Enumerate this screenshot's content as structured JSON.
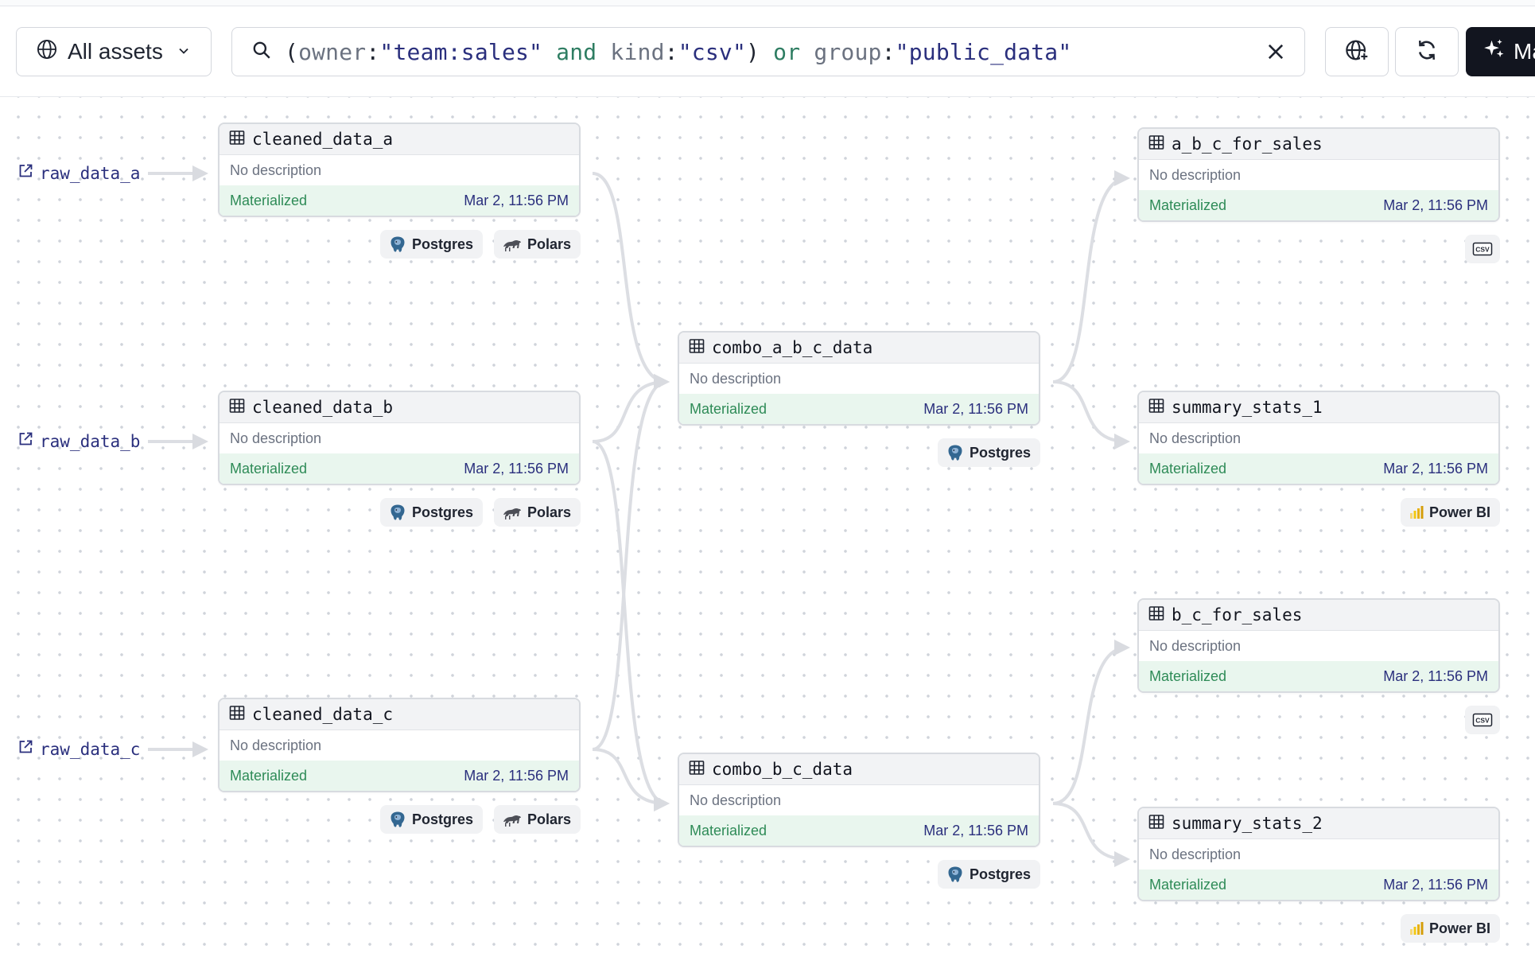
{
  "toolbar": {
    "assets_label": "All assets",
    "query": [
      {
        "t": "(",
        "c": "pun"
      },
      {
        "t": "owner",
        "c": "key"
      },
      {
        "t": ":",
        "c": "pun"
      },
      {
        "t": "\"team:sales\"",
        "c": "val"
      },
      {
        "t": " and ",
        "c": "kw"
      },
      {
        "t": "kind",
        "c": "key"
      },
      {
        "t": ":",
        "c": "pun"
      },
      {
        "t": "\"csv\"",
        "c": "val"
      },
      {
        "t": ")",
        "c": "pun"
      },
      {
        "t": " or ",
        "c": "kw"
      },
      {
        "t": "group",
        "c": "key"
      },
      {
        "t": ":",
        "c": "pun"
      },
      {
        "t": "\"public_data\"",
        "c": "val"
      }
    ],
    "ai_label": "Ma"
  },
  "sources": [
    {
      "label": "raw_data_a"
    },
    {
      "label": "raw_data_b"
    },
    {
      "label": "raw_data_c"
    }
  ],
  "nodes": [
    {
      "title": "cleaned_data_a",
      "desc": "No description",
      "status": "Materialized",
      "time": "Mar 2, 11:56 PM",
      "tags": [
        "Postgres",
        "Polars"
      ]
    },
    {
      "title": "cleaned_data_b",
      "desc": "No description",
      "status": "Materialized",
      "time": "Mar 2, 11:56 PM",
      "tags": [
        "Postgres",
        "Polars"
      ]
    },
    {
      "title": "cleaned_data_c",
      "desc": "No description",
      "status": "Materialized",
      "time": "Mar 2, 11:56 PM",
      "tags": [
        "Postgres",
        "Polars"
      ]
    },
    {
      "title": "combo_a_b_c_data",
      "desc": "No description",
      "status": "Materialized",
      "time": "Mar 2, 11:56 PM",
      "tags": [
        "Postgres"
      ]
    },
    {
      "title": "combo_b_c_data",
      "desc": "No description",
      "status": "Materialized",
      "time": "Mar 2, 11:56 PM",
      "tags": [
        "Postgres"
      ]
    },
    {
      "title": "a_b_c_for_sales",
      "desc": "No description",
      "status": "Materialized",
      "time": "Mar 2, 11:56 PM",
      "tags": [
        "CSV"
      ]
    },
    {
      "title": "summary_stats_1",
      "desc": "No description",
      "status": "Materialized",
      "time": "Mar 2, 11:56 PM",
      "tags": [
        "Power BI"
      ]
    },
    {
      "title": "b_c_for_sales",
      "desc": "No description",
      "status": "Materialized",
      "time": "Mar 2, 11:56 PM",
      "tags": [
        "CSV"
      ]
    },
    {
      "title": "summary_stats_2",
      "desc": "No description",
      "status": "Materialized",
      "time": "Mar 2, 11:56 PM",
      "tags": [
        "Power BI"
      ]
    }
  ],
  "colors": {
    "status_green": "#2e8b57",
    "status_bg": "#e9f6ee",
    "link_navy": "#2a2f7d",
    "edge_gray": "#d9dbe0",
    "ai_button_bg": "#12151f"
  },
  "icons": {
    "assets": "globe-icon",
    "search": "search-icon",
    "clear": "close-icon",
    "network": "globe-plus-icon",
    "reload": "refresh-icon",
    "ai": "sparkles-icon",
    "node": "table-icon",
    "source": "external-link-icon"
  }
}
